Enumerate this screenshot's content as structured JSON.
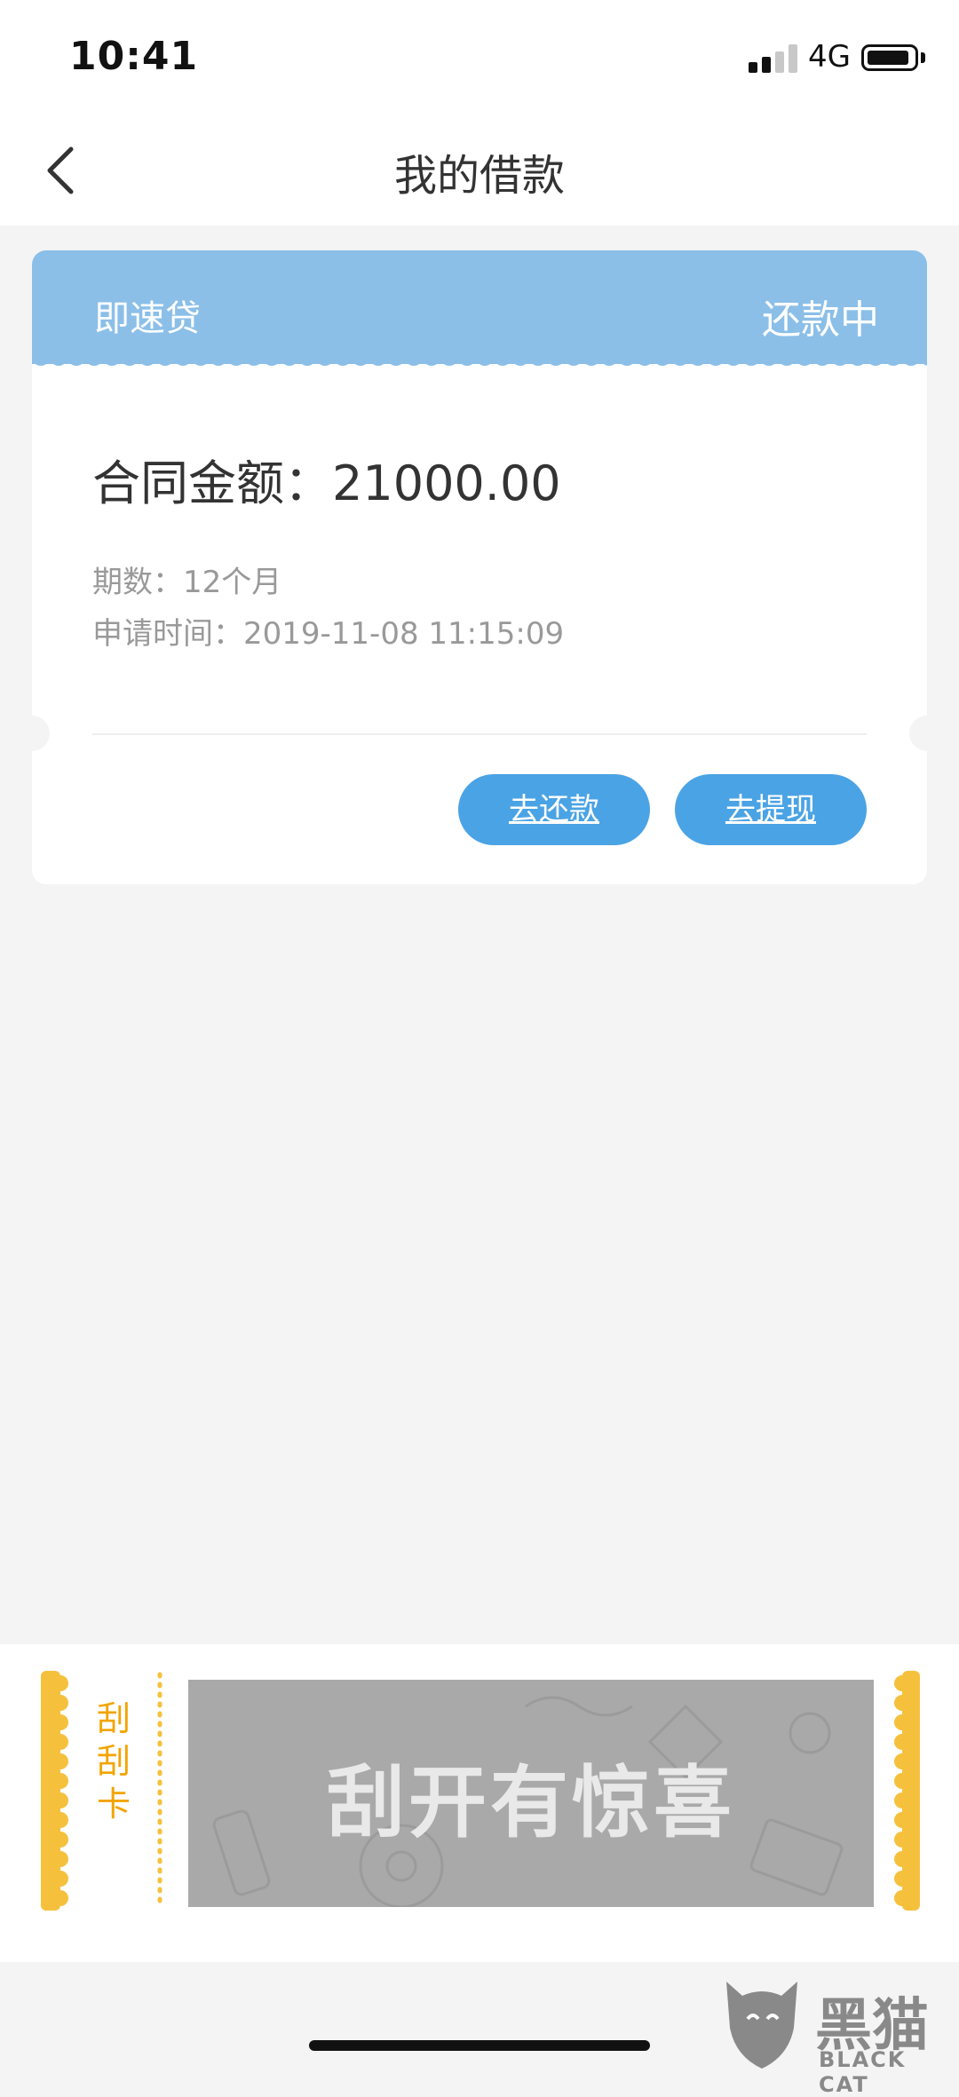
{
  "status_bar": {
    "time": "10:41",
    "network": "4G"
  },
  "nav": {
    "title": "我的借款"
  },
  "loan": {
    "product": "即速贷",
    "status": "还款中",
    "contract_amount": "合同金额：21000.00",
    "periods": "期数：12个月",
    "apply_time": "申请时间：2019-11-08 11:15:09",
    "repay_button": "去还款",
    "withdraw_button": "去提现"
  },
  "scratch_card": {
    "label": "刮刮卡",
    "text": "刮开有惊喜"
  },
  "watermark": {
    "name": "黑猫",
    "subtitle": "BLACK CAT"
  },
  "colors": {
    "header_blue": "#8bbfe8",
    "button_blue": "#4aa3e4",
    "scratch_gold": "#f5c13d"
  }
}
